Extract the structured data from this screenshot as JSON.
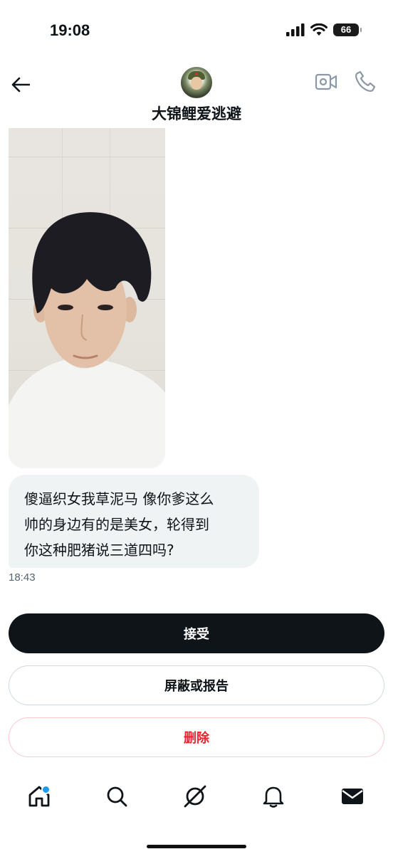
{
  "status_bar": {
    "time": "19:08",
    "battery": "66"
  },
  "header": {
    "contact_name": "大锦鲤爱逃避"
  },
  "message": {
    "lines": [
      "傻逼织女我草泥马 像你爹这么",
      "帅的身边有的是美女，轮得到",
      "你这种肥猪说三道四吗?"
    ],
    "time": "18:43"
  },
  "actions": {
    "accept": "接受",
    "block_or_report": "屏蔽或报告",
    "delete": "删除"
  },
  "tab_bar": {
    "icons": [
      "home-icon",
      "search-icon",
      "grok-icon",
      "bell-icon",
      "mail-icon"
    ],
    "home_has_notification": true
  },
  "colors": {
    "accent": "#1d9bf0",
    "danger": "#f4212e",
    "primary": "#0f1419",
    "bubble": "#eff3f4"
  }
}
